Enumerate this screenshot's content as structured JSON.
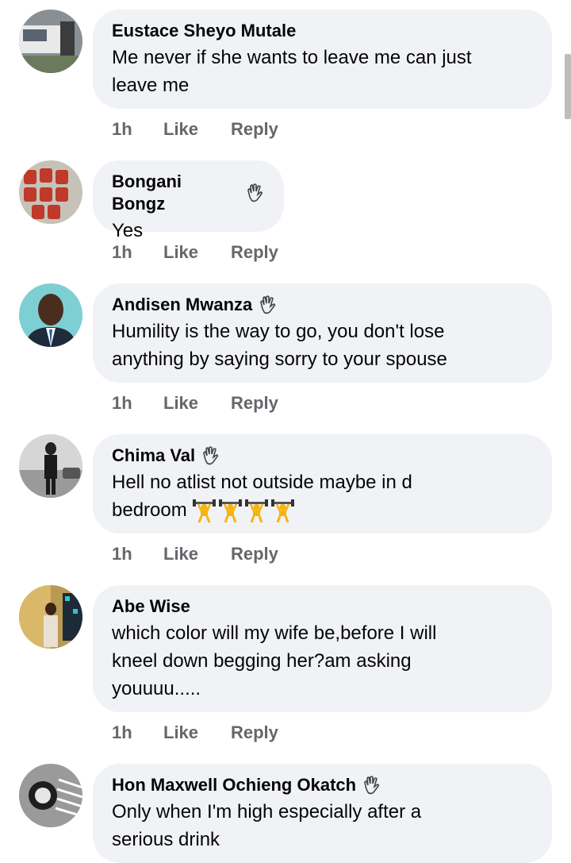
{
  "comments": [
    {
      "name": "Eustace Sheyo Mutale",
      "badge": false,
      "text": "Me never if she wants to leave me can just\nleave me",
      "time": "1h",
      "like": "Like",
      "reply": "Reply",
      "avatar": "avatar-photo"
    },
    {
      "name": "Bongani Bongz",
      "badge": true,
      "text": "Yes",
      "time": "1h",
      "like": "Like",
      "reply": "Reply",
      "avatar": "avatar-photo"
    },
    {
      "name": "Andisen Mwanza",
      "badge": true,
      "text": "Humility is the way to go, you don't lose\nanything by saying sorry to your spouse",
      "time": "1h",
      "like": "Like",
      "reply": "Reply",
      "avatar": "avatar-photo"
    },
    {
      "name": "Chima Val",
      "badge": true,
      "text": "Hell no atlist not outside maybe in d\nbedroom",
      "emoji": "weightlifter-emoji x4",
      "time": "1h",
      "like": "Like",
      "reply": "Reply",
      "avatar": "avatar-photo"
    },
    {
      "name": "Abe Wise",
      "badge": false,
      "text": "which color will my wife be,before I will\nkneel down begging her?am asking\nyouuuu.....",
      "time": "1h",
      "like": "Like",
      "reply": "Reply",
      "avatar": "avatar-photo"
    },
    {
      "name": "Hon Maxwell Ochieng Okatch",
      "badge": true,
      "text": "Only when I'm high especially after a\nserious drink",
      "avatar": "avatar-photo"
    }
  ],
  "icons": {
    "badge": "waving-hand-icon"
  },
  "colors": {
    "bubble": "#f0f2f5",
    "meta": "#65676b",
    "text": "#050505"
  }
}
